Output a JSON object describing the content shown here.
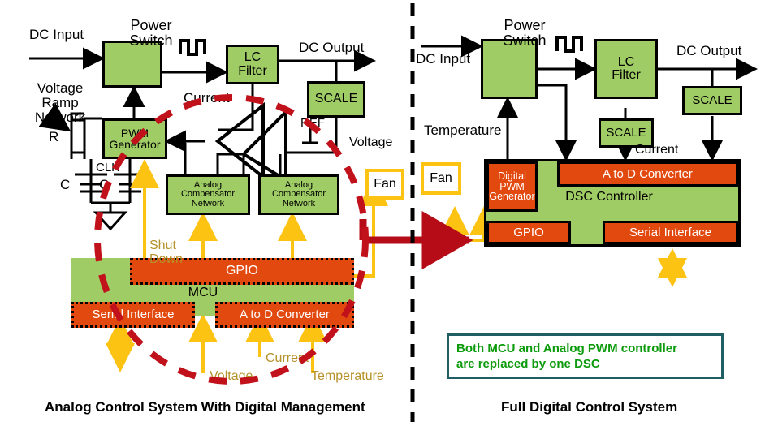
{
  "meta": {
    "colors": {
      "green": "#9fcc64",
      "orange": "#e2490e",
      "yellow": "#fdc313",
      "yellow_text": "#b5912a",
      "red_dash": "#c1121c",
      "note_border": "#1f5f63",
      "note_text": "#0c9b0c",
      "black": "#000000"
    }
  },
  "left_panel": {
    "caption": "Analog Control System With Digital Management",
    "labels": {
      "power_switch": "Power\nSwitch",
      "dc_input": "DC Input",
      "dc_output": "DC Output",
      "voltage_ramp_network": "Voltage\nRamp\nNetwork",
      "r": "R",
      "clk": "CLK",
      "c1": "C",
      "c2": "C",
      "current": "Current",
      "ref": "REF",
      "voltage_side": "Voltage",
      "shut_down": "Shut\nDown",
      "adc_voltage": "Voltage",
      "adc_current": "Current",
      "adc_temperature": "Temperature"
    },
    "blocks": {
      "power_switch": "",
      "lc_filter": "LC\nFilter",
      "scale": "SCALE",
      "pwm_generator": "PWM\nGenerator",
      "analog_comp_1": "Analog\nCompensator\nNetwork",
      "analog_comp_2": "Analog\nCompensator\nNetwork",
      "fan": "Fan",
      "mcu": "MCU",
      "gpio": "GPIO",
      "serial_interface": "Serial Interface",
      "a_to_d": "A to D Converter"
    }
  },
  "right_panel": {
    "caption": "Full Digital Control System",
    "labels": {
      "power_switch": "Power\nSwitch",
      "dc_input": "DC Input",
      "dc_output": "DC Output",
      "temperature": "Temperature",
      "current": "Current"
    },
    "blocks": {
      "lc_filter": "LC\nFilter",
      "scale_current": "SCALE",
      "scale_voltage": "SCALE",
      "fan": "Fan",
      "digital_pwm_generator": "Digital\nPWM\nGenerator",
      "dsc_controller": "DSC Controller",
      "a_to_d": "A to D Converter",
      "gpio": "GPIO",
      "serial_interface": "Serial Interface"
    },
    "note": "Both MCU and Analog PWM controller\nare replaced by one DSC"
  }
}
